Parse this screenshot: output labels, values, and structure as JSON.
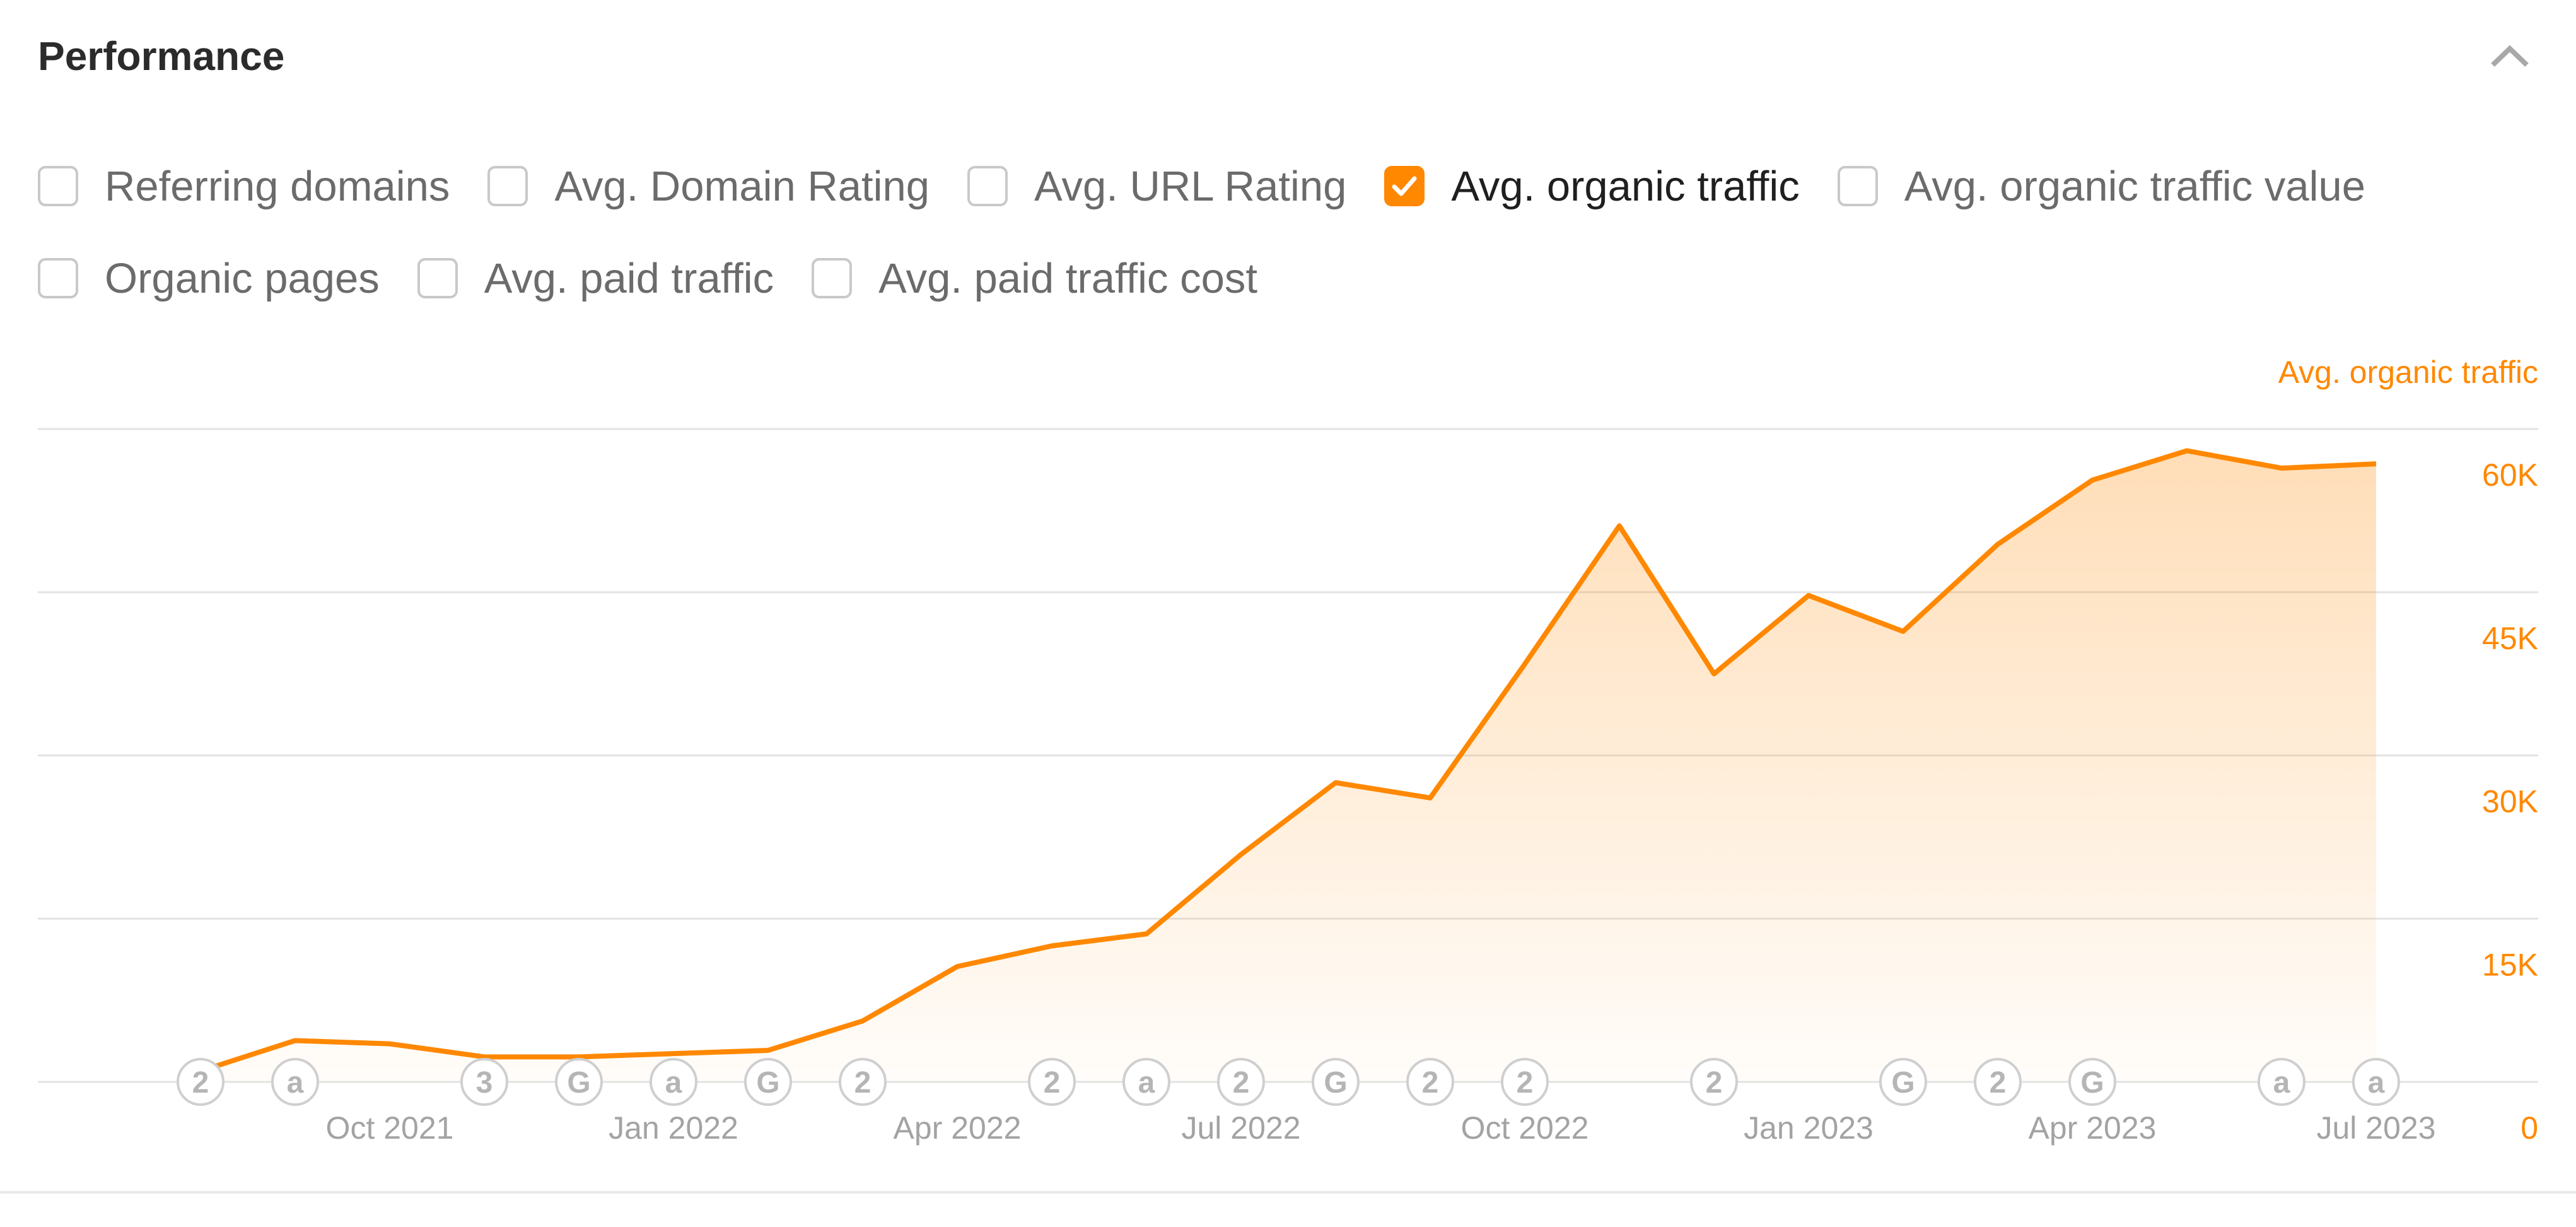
{
  "header": {
    "title": "Performance",
    "collapse_icon": "chevron-up-icon"
  },
  "metrics": {
    "rows": [
      [
        {
          "label": "Referring domains",
          "checked": false
        },
        {
          "label": "Avg. Domain Rating",
          "checked": false
        },
        {
          "label": "Avg. URL Rating",
          "checked": false
        },
        {
          "label": "Avg. organic traffic",
          "checked": true
        },
        {
          "label": "Avg. organic traffic value",
          "checked": false
        }
      ],
      [
        {
          "label": "Organic pages",
          "checked": false
        },
        {
          "label": "Avg. paid traffic",
          "checked": false
        },
        {
          "label": "Avg. paid traffic cost",
          "checked": false
        }
      ]
    ]
  },
  "colors": {
    "accent": "#ff8800",
    "grid": "#e3e3e3",
    "axis_text": "#a3a3a3",
    "annotation": "#b5b5b5"
  },
  "chart_data": {
    "type": "area",
    "title": "",
    "series_label": "Avg. organic traffic",
    "ylabel": "Avg. organic traffic",
    "y_axis_position": "right",
    "ylim": [
      0,
      60000
    ],
    "y_ticks": [
      0,
      15000,
      30000,
      45000,
      60000
    ],
    "y_tick_labels": [
      "0",
      "15K",
      "30K",
      "45K",
      "60K"
    ],
    "grid": true,
    "x": [
      "Aug 2021",
      "Sep 2021",
      "Oct 2021",
      "Nov 2021",
      "Dec 2021",
      "Jan 2022",
      "Feb 2022",
      "Mar 2022",
      "Apr 2022",
      "May 2022",
      "Jun 2022",
      "Jul 2022",
      "Aug 2022",
      "Sep 2022",
      "Oct 2022",
      "Nov 2022",
      "Dec 2022",
      "Jan 2023",
      "Feb 2023",
      "Mar 2023",
      "Apr 2023",
      "May 2023",
      "Jun 2023",
      "Jul 2023"
    ],
    "x_tick_labels": [
      {
        "label": "Oct 2021",
        "at": "Oct 2021"
      },
      {
        "label": "Jan 2022",
        "at": "Jan 2022"
      },
      {
        "label": "Apr 2022",
        "at": "Apr 2022"
      },
      {
        "label": "Jul 2022",
        "at": "Jul 2022"
      },
      {
        "label": "Oct 2022",
        "at": "Oct 2022"
      },
      {
        "label": "Jan 2023",
        "at": "Jan 2023"
      },
      {
        "label": "Apr 2023",
        "at": "Apr 2023"
      },
      {
        "label": "Jul 2023",
        "at": "Jul 2023"
      }
    ],
    "series": [
      {
        "name": "Avg. organic traffic",
        "values": [
          1000,
          3800,
          3500,
          2300,
          2300,
          2600,
          2900,
          5600,
          10600,
          12500,
          13600,
          20900,
          27500,
          26100,
          38400,
          51100,
          37500,
          44700,
          41400,
          49400,
          55300,
          58000,
          56400,
          56800
        ]
      }
    ],
    "annotations": [
      {
        "at": "Aug 2021",
        "glyph": "2"
      },
      {
        "at": "Sep 2021",
        "glyph": "a"
      },
      {
        "at": "Nov 2021",
        "glyph": "3"
      },
      {
        "at": "Dec 2021",
        "glyph": "G"
      },
      {
        "at": "Jan 2022",
        "glyph": "a"
      },
      {
        "at": "Feb 2022",
        "glyph": "G"
      },
      {
        "at": "Mar 2022",
        "glyph": "2"
      },
      {
        "at": "May 2022",
        "glyph": "2"
      },
      {
        "at": "Jun 2022",
        "glyph": "a"
      },
      {
        "at": "Jul 2022",
        "glyph": "2"
      },
      {
        "at": "Aug 2022",
        "glyph": "G"
      },
      {
        "at": "Sep 2022",
        "glyph": "2"
      },
      {
        "at": "Oct 2022",
        "glyph": "2"
      },
      {
        "at": "Dec 2022",
        "glyph": "2"
      },
      {
        "at": "Feb 2023",
        "glyph": "G"
      },
      {
        "at": "Mar 2023",
        "glyph": "2"
      },
      {
        "at": "Apr 2023",
        "glyph": "G"
      },
      {
        "at": "Jun 2023",
        "glyph": "a"
      },
      {
        "at": "Jul 2023",
        "glyph": "a"
      }
    ]
  }
}
